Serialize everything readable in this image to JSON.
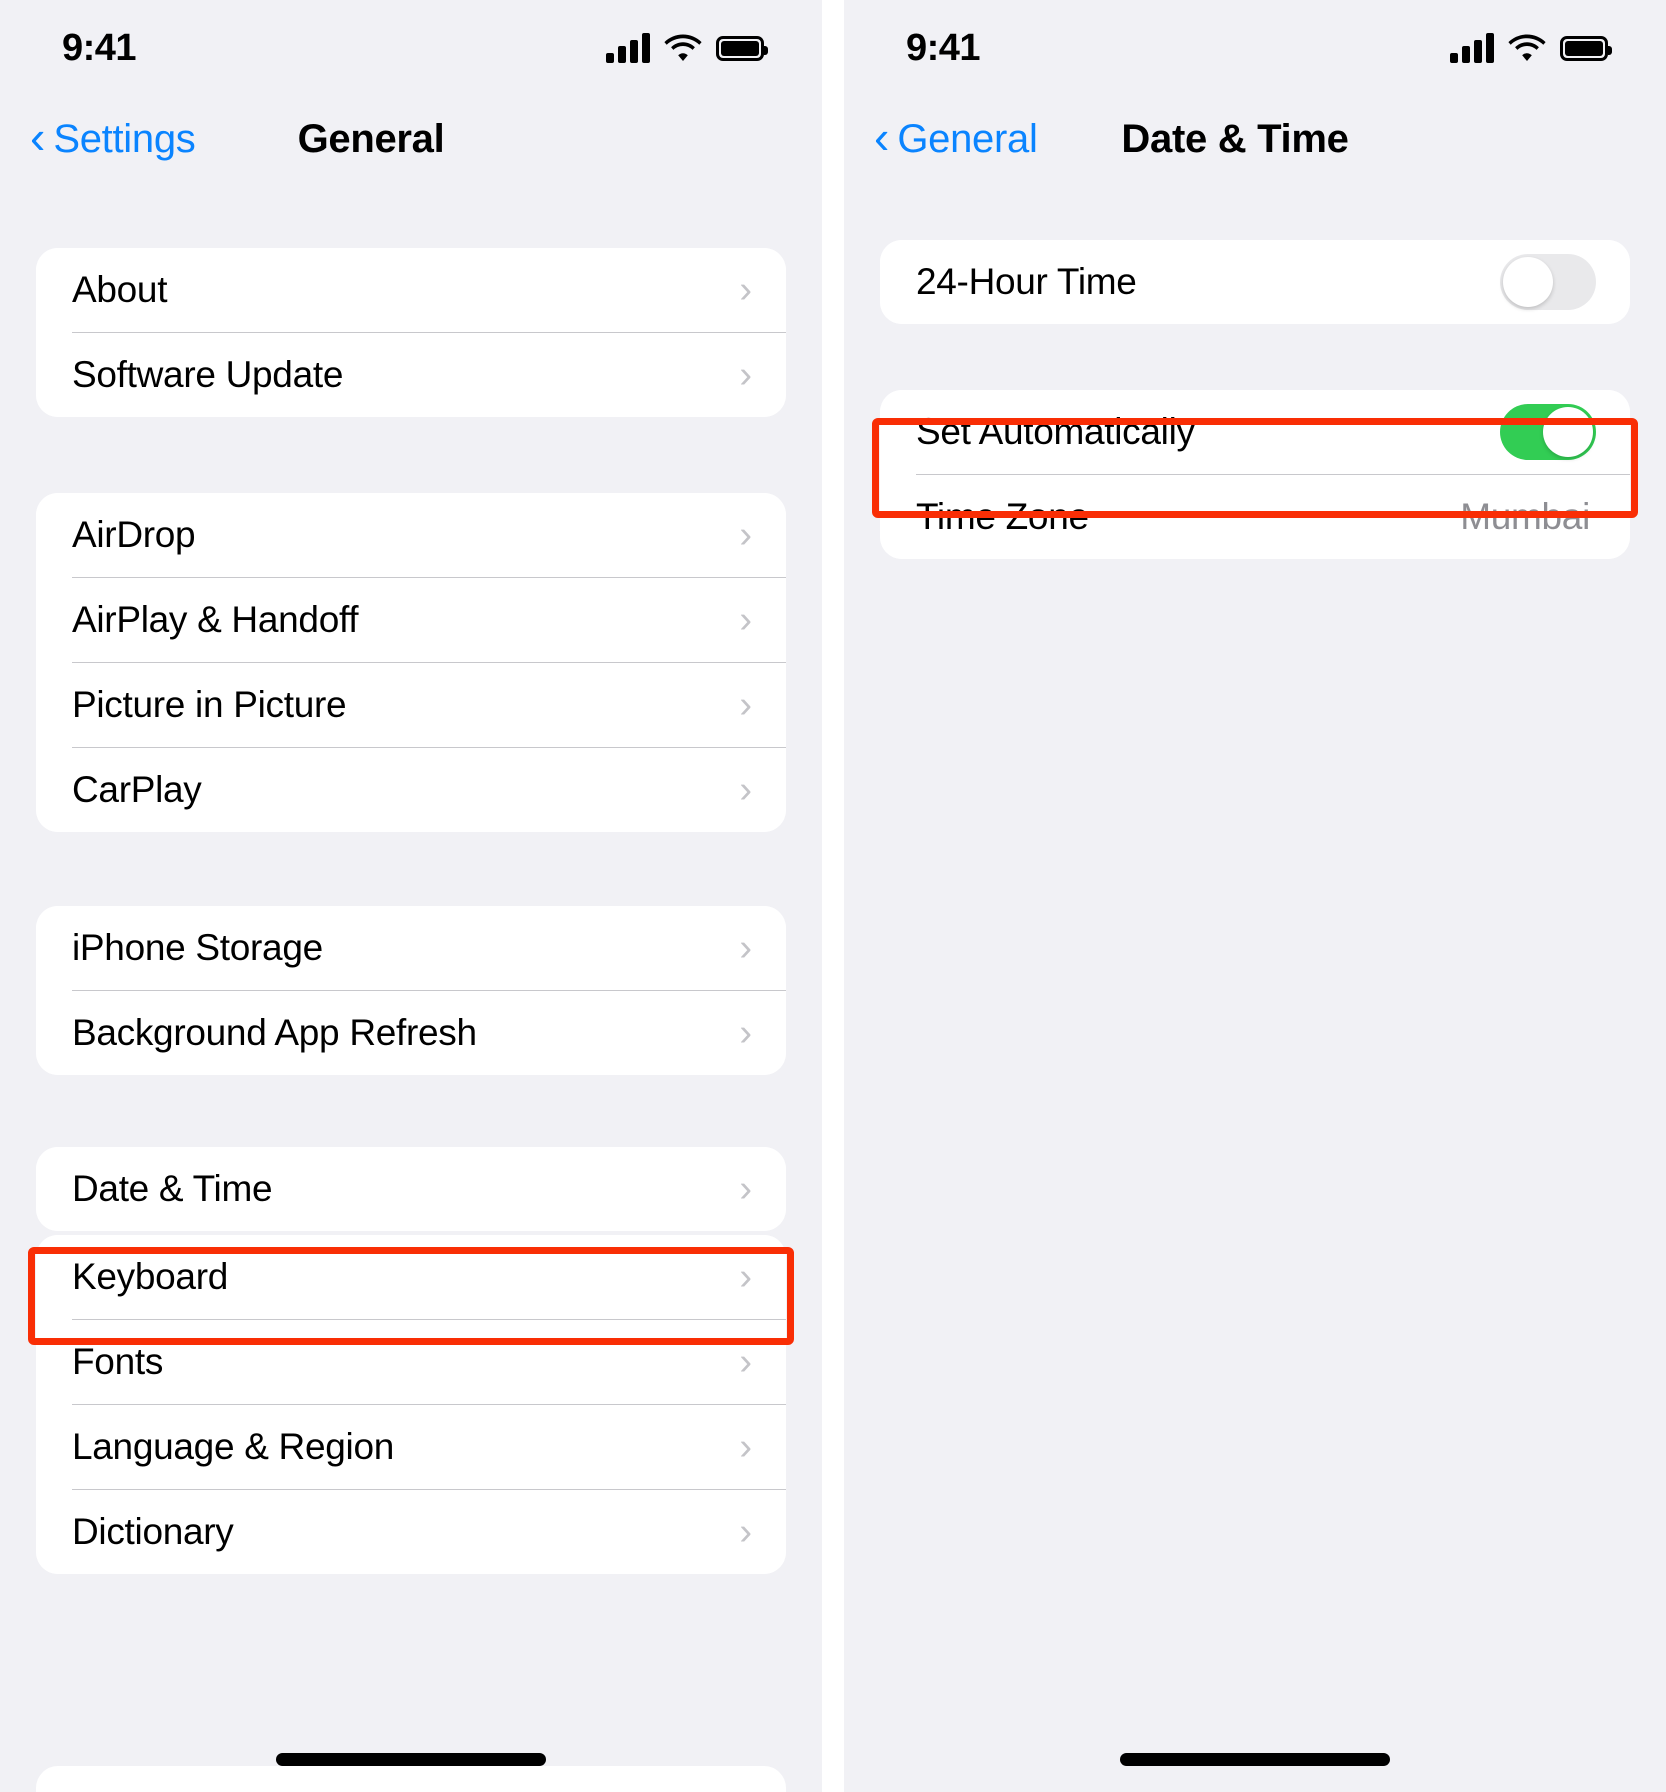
{
  "left_screen": {
    "status_bar": {
      "time": "9:41",
      "cellular_icon": "cellular-bars-icon",
      "wifi_icon": "wifi-icon",
      "battery_icon": "battery-full-icon"
    },
    "nav": {
      "back_label": "Settings",
      "back_icon": "chevron-left-icon",
      "title": "General"
    },
    "groups": [
      {
        "rows": [
          {
            "label": "About",
            "accessory": "chevron"
          },
          {
            "label": "Software Update",
            "accessory": "chevron"
          }
        ]
      },
      {
        "rows": [
          {
            "label": "AirDrop",
            "accessory": "chevron"
          },
          {
            "label": "AirPlay & Handoff",
            "accessory": "chevron"
          },
          {
            "label": "Picture in Picture",
            "accessory": "chevron"
          },
          {
            "label": "CarPlay",
            "accessory": "chevron"
          }
        ]
      },
      {
        "rows": [
          {
            "label": "iPhone Storage",
            "accessory": "chevron"
          },
          {
            "label": "Background App Refresh",
            "accessory": "chevron"
          }
        ]
      },
      {
        "rows": [
          {
            "label": "Date & Time",
            "accessory": "chevron",
            "highlighted": true
          }
        ]
      },
      {
        "rows": [
          {
            "label": "Keyboard",
            "accessory": "chevron"
          },
          {
            "label": "Fonts",
            "accessory": "chevron"
          },
          {
            "label": "Language & Region",
            "accessory": "chevron"
          },
          {
            "label": "Dictionary",
            "accessory": "chevron"
          }
        ]
      }
    ]
  },
  "right_screen": {
    "status_bar": {
      "time": "9:41",
      "cellular_icon": "cellular-bars-icon",
      "wifi_icon": "wifi-icon",
      "battery_icon": "battery-full-icon"
    },
    "nav": {
      "back_label": "General",
      "back_icon": "chevron-left-icon",
      "title": "Date & Time"
    },
    "groups": [
      {
        "rows": [
          {
            "label": "24-Hour Time",
            "accessory": "toggle",
            "toggle_state": "off"
          }
        ]
      },
      {
        "rows": [
          {
            "label": "Set Automatically",
            "accessory": "toggle",
            "toggle_state": "on",
            "highlighted": true
          },
          {
            "label": "Time Zone",
            "accessory": "value",
            "value": "Mumbai"
          }
        ]
      }
    ]
  },
  "colors": {
    "accent_blue": "#0a84ff",
    "toggle_on_green": "#32cd54",
    "toggle_off_gray": "#e9e9eb",
    "highlight_red": "#f92e05",
    "page_background": "#f1f1f5",
    "card_background": "#ffffff",
    "secondary_text": "#8e8e93",
    "chevron_gray": "#c4c4c8"
  },
  "chevron_glyph": "›"
}
